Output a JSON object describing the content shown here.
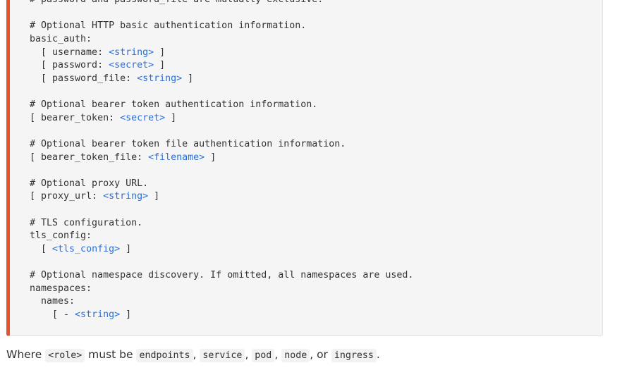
{
  "code_lines": [
    [
      {
        "t": "# password and password_file are mutually exclusive."
      }
    ],
    [
      {
        "t": ""
      }
    ],
    [
      {
        "t": "# Optional HTTP basic authentication information."
      }
    ],
    [
      {
        "t": "basic_auth:"
      }
    ],
    [
      {
        "t": "  [ username: "
      },
      {
        "t": "<string>",
        "ph": true
      },
      {
        "t": " ]"
      }
    ],
    [
      {
        "t": "  [ password: "
      },
      {
        "t": "<secret>",
        "ph": true
      },
      {
        "t": " ]"
      }
    ],
    [
      {
        "t": "  [ password_file: "
      },
      {
        "t": "<string>",
        "ph": true
      },
      {
        "t": " ]"
      }
    ],
    [
      {
        "t": ""
      }
    ],
    [
      {
        "t": "# Optional bearer token authentication information."
      }
    ],
    [
      {
        "t": "[ bearer_token: "
      },
      {
        "t": "<secret>",
        "ph": true
      },
      {
        "t": " ]"
      }
    ],
    [
      {
        "t": ""
      }
    ],
    [
      {
        "t": "# Optional bearer token file authentication information."
      }
    ],
    [
      {
        "t": "[ bearer_token_file: "
      },
      {
        "t": "<filename>",
        "ph": true
      },
      {
        "t": " ]"
      }
    ],
    [
      {
        "t": ""
      }
    ],
    [
      {
        "t": "# Optional proxy URL."
      }
    ],
    [
      {
        "t": "[ proxy_url: "
      },
      {
        "t": "<string>",
        "ph": true
      },
      {
        "t": " ]"
      }
    ],
    [
      {
        "t": ""
      }
    ],
    [
      {
        "t": "# TLS configuration."
      }
    ],
    [
      {
        "t": "tls_config:"
      }
    ],
    [
      {
        "t": "  [ "
      },
      {
        "t": "<tls_config>",
        "ph": true
      },
      {
        "t": " ]"
      }
    ],
    [
      {
        "t": ""
      }
    ],
    [
      {
        "t": "# Optional namespace discovery. If omitted, all namespaces are used."
      }
    ],
    [
      {
        "t": "namespaces:"
      }
    ],
    [
      {
        "t": "  names:"
      }
    ],
    [
      {
        "t": "    [ - "
      },
      {
        "t": "<string>",
        "ph": true
      },
      {
        "t": " ]"
      }
    ]
  ],
  "paragraph": {
    "prefix": "Where ",
    "role_code": "<role>",
    "mid": " must be ",
    "roles": [
      "endpoints",
      "service",
      "pod",
      "node",
      "ingress"
    ],
    "sep": ", ",
    "or_sep": ", or ",
    "suffix": "."
  },
  "colors": {
    "accent_border": "#e6522c",
    "placeholder": "#2a6fdb",
    "code_bg": "#f5f5f5",
    "text": "#333333"
  }
}
